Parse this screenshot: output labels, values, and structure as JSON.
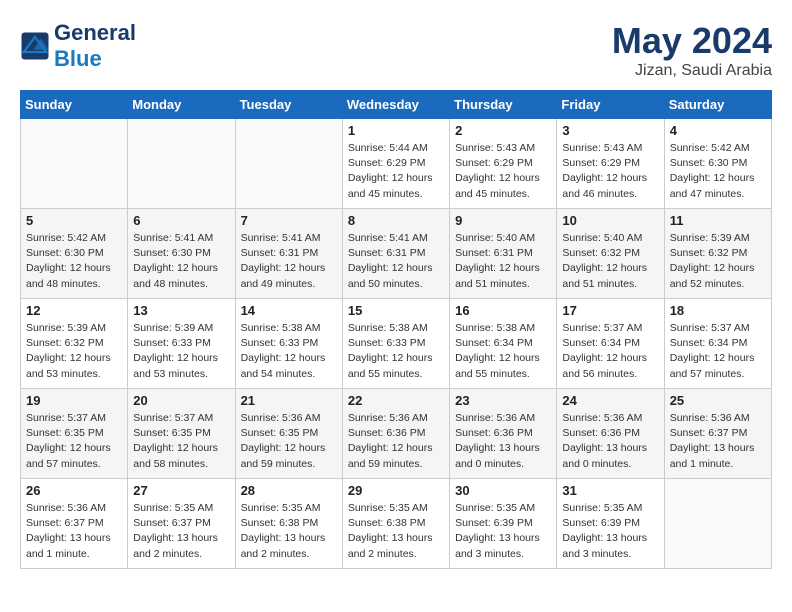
{
  "header": {
    "logo_general": "General",
    "logo_blue": "Blue",
    "month_title": "May 2024",
    "location": "Jizan, Saudi Arabia"
  },
  "days_of_week": [
    "Sunday",
    "Monday",
    "Tuesday",
    "Wednesday",
    "Thursday",
    "Friday",
    "Saturday"
  ],
  "weeks": [
    [
      {
        "day": "",
        "info": ""
      },
      {
        "day": "",
        "info": ""
      },
      {
        "day": "",
        "info": ""
      },
      {
        "day": "1",
        "info": "Sunrise: 5:44 AM\nSunset: 6:29 PM\nDaylight: 12 hours\nand 45 minutes."
      },
      {
        "day": "2",
        "info": "Sunrise: 5:43 AM\nSunset: 6:29 PM\nDaylight: 12 hours\nand 45 minutes."
      },
      {
        "day": "3",
        "info": "Sunrise: 5:43 AM\nSunset: 6:29 PM\nDaylight: 12 hours\nand 46 minutes."
      },
      {
        "day": "4",
        "info": "Sunrise: 5:42 AM\nSunset: 6:30 PM\nDaylight: 12 hours\nand 47 minutes."
      }
    ],
    [
      {
        "day": "5",
        "info": "Sunrise: 5:42 AM\nSunset: 6:30 PM\nDaylight: 12 hours\nand 48 minutes."
      },
      {
        "day": "6",
        "info": "Sunrise: 5:41 AM\nSunset: 6:30 PM\nDaylight: 12 hours\nand 48 minutes."
      },
      {
        "day": "7",
        "info": "Sunrise: 5:41 AM\nSunset: 6:31 PM\nDaylight: 12 hours\nand 49 minutes."
      },
      {
        "day": "8",
        "info": "Sunrise: 5:41 AM\nSunset: 6:31 PM\nDaylight: 12 hours\nand 50 minutes."
      },
      {
        "day": "9",
        "info": "Sunrise: 5:40 AM\nSunset: 6:31 PM\nDaylight: 12 hours\nand 51 minutes."
      },
      {
        "day": "10",
        "info": "Sunrise: 5:40 AM\nSunset: 6:32 PM\nDaylight: 12 hours\nand 51 minutes."
      },
      {
        "day": "11",
        "info": "Sunrise: 5:39 AM\nSunset: 6:32 PM\nDaylight: 12 hours\nand 52 minutes."
      }
    ],
    [
      {
        "day": "12",
        "info": "Sunrise: 5:39 AM\nSunset: 6:32 PM\nDaylight: 12 hours\nand 53 minutes."
      },
      {
        "day": "13",
        "info": "Sunrise: 5:39 AM\nSunset: 6:33 PM\nDaylight: 12 hours\nand 53 minutes."
      },
      {
        "day": "14",
        "info": "Sunrise: 5:38 AM\nSunset: 6:33 PM\nDaylight: 12 hours\nand 54 minutes."
      },
      {
        "day": "15",
        "info": "Sunrise: 5:38 AM\nSunset: 6:33 PM\nDaylight: 12 hours\nand 55 minutes."
      },
      {
        "day": "16",
        "info": "Sunrise: 5:38 AM\nSunset: 6:34 PM\nDaylight: 12 hours\nand 55 minutes."
      },
      {
        "day": "17",
        "info": "Sunrise: 5:37 AM\nSunset: 6:34 PM\nDaylight: 12 hours\nand 56 minutes."
      },
      {
        "day": "18",
        "info": "Sunrise: 5:37 AM\nSunset: 6:34 PM\nDaylight: 12 hours\nand 57 minutes."
      }
    ],
    [
      {
        "day": "19",
        "info": "Sunrise: 5:37 AM\nSunset: 6:35 PM\nDaylight: 12 hours\nand 57 minutes."
      },
      {
        "day": "20",
        "info": "Sunrise: 5:37 AM\nSunset: 6:35 PM\nDaylight: 12 hours\nand 58 minutes."
      },
      {
        "day": "21",
        "info": "Sunrise: 5:36 AM\nSunset: 6:35 PM\nDaylight: 12 hours\nand 59 minutes."
      },
      {
        "day": "22",
        "info": "Sunrise: 5:36 AM\nSunset: 6:36 PM\nDaylight: 12 hours\nand 59 minutes."
      },
      {
        "day": "23",
        "info": "Sunrise: 5:36 AM\nSunset: 6:36 PM\nDaylight: 13 hours\nand 0 minutes."
      },
      {
        "day": "24",
        "info": "Sunrise: 5:36 AM\nSunset: 6:36 PM\nDaylight: 13 hours\nand 0 minutes."
      },
      {
        "day": "25",
        "info": "Sunrise: 5:36 AM\nSunset: 6:37 PM\nDaylight: 13 hours\nand 1 minute."
      }
    ],
    [
      {
        "day": "26",
        "info": "Sunrise: 5:36 AM\nSunset: 6:37 PM\nDaylight: 13 hours\nand 1 minute."
      },
      {
        "day": "27",
        "info": "Sunrise: 5:35 AM\nSunset: 6:37 PM\nDaylight: 13 hours\nand 2 minutes."
      },
      {
        "day": "28",
        "info": "Sunrise: 5:35 AM\nSunset: 6:38 PM\nDaylight: 13 hours\nand 2 minutes."
      },
      {
        "day": "29",
        "info": "Sunrise: 5:35 AM\nSunset: 6:38 PM\nDaylight: 13 hours\nand 2 minutes."
      },
      {
        "day": "30",
        "info": "Sunrise: 5:35 AM\nSunset: 6:39 PM\nDaylight: 13 hours\nand 3 minutes."
      },
      {
        "day": "31",
        "info": "Sunrise: 5:35 AM\nSunset: 6:39 PM\nDaylight: 13 hours\nand 3 minutes."
      },
      {
        "day": "",
        "info": ""
      }
    ]
  ]
}
